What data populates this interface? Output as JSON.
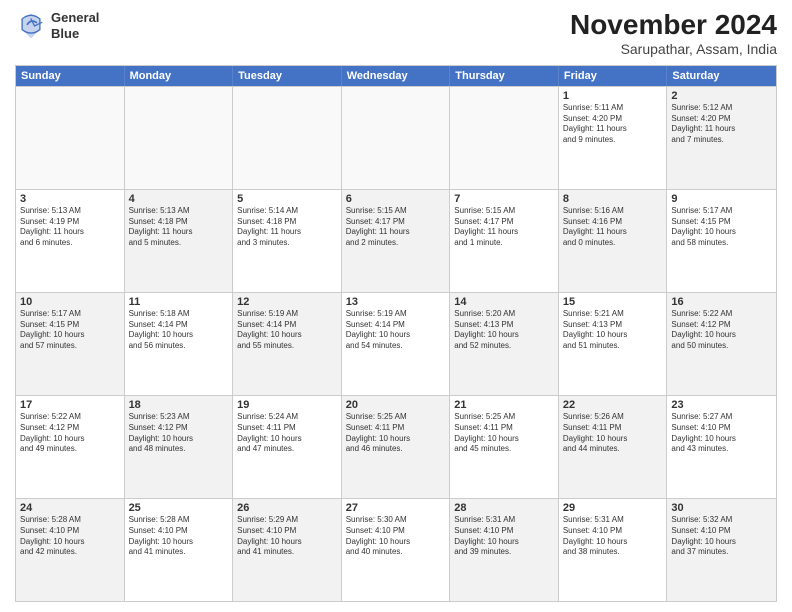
{
  "logo": {
    "line1": "General",
    "line2": "Blue"
  },
  "title": "November 2024",
  "subtitle": "Sarupathar, Assam, India",
  "header_days": [
    "Sunday",
    "Monday",
    "Tuesday",
    "Wednesday",
    "Thursday",
    "Friday",
    "Saturday"
  ],
  "rows": [
    [
      {
        "day": "",
        "info": "",
        "empty": true
      },
      {
        "day": "",
        "info": "",
        "empty": true
      },
      {
        "day": "",
        "info": "",
        "empty": true
      },
      {
        "day": "",
        "info": "",
        "empty": true
      },
      {
        "day": "",
        "info": "",
        "empty": true
      },
      {
        "day": "1",
        "info": "Sunrise: 5:11 AM\nSunset: 4:20 PM\nDaylight: 11 hours\nand 9 minutes.",
        "empty": false
      },
      {
        "day": "2",
        "info": "Sunrise: 5:12 AM\nSunset: 4:20 PM\nDaylight: 11 hours\nand 7 minutes.",
        "empty": false,
        "shaded": true
      }
    ],
    [
      {
        "day": "3",
        "info": "Sunrise: 5:13 AM\nSunset: 4:19 PM\nDaylight: 11 hours\nand 6 minutes.",
        "empty": false
      },
      {
        "day": "4",
        "info": "Sunrise: 5:13 AM\nSunset: 4:18 PM\nDaylight: 11 hours\nand 5 minutes.",
        "empty": false,
        "shaded": true
      },
      {
        "day": "5",
        "info": "Sunrise: 5:14 AM\nSunset: 4:18 PM\nDaylight: 11 hours\nand 3 minutes.",
        "empty": false
      },
      {
        "day": "6",
        "info": "Sunrise: 5:15 AM\nSunset: 4:17 PM\nDaylight: 11 hours\nand 2 minutes.",
        "empty": false,
        "shaded": true
      },
      {
        "day": "7",
        "info": "Sunrise: 5:15 AM\nSunset: 4:17 PM\nDaylight: 11 hours\nand 1 minute.",
        "empty": false
      },
      {
        "day": "8",
        "info": "Sunrise: 5:16 AM\nSunset: 4:16 PM\nDaylight: 11 hours\nand 0 minutes.",
        "empty": false,
        "shaded": true
      },
      {
        "day": "9",
        "info": "Sunrise: 5:17 AM\nSunset: 4:15 PM\nDaylight: 10 hours\nand 58 minutes.",
        "empty": false
      }
    ],
    [
      {
        "day": "10",
        "info": "Sunrise: 5:17 AM\nSunset: 4:15 PM\nDaylight: 10 hours\nand 57 minutes.",
        "empty": false,
        "shaded": true
      },
      {
        "day": "11",
        "info": "Sunrise: 5:18 AM\nSunset: 4:14 PM\nDaylight: 10 hours\nand 56 minutes.",
        "empty": false
      },
      {
        "day": "12",
        "info": "Sunrise: 5:19 AM\nSunset: 4:14 PM\nDaylight: 10 hours\nand 55 minutes.",
        "empty": false,
        "shaded": true
      },
      {
        "day": "13",
        "info": "Sunrise: 5:19 AM\nSunset: 4:14 PM\nDaylight: 10 hours\nand 54 minutes.",
        "empty": false
      },
      {
        "day": "14",
        "info": "Sunrise: 5:20 AM\nSunset: 4:13 PM\nDaylight: 10 hours\nand 52 minutes.",
        "empty": false,
        "shaded": true
      },
      {
        "day": "15",
        "info": "Sunrise: 5:21 AM\nSunset: 4:13 PM\nDaylight: 10 hours\nand 51 minutes.",
        "empty": false
      },
      {
        "day": "16",
        "info": "Sunrise: 5:22 AM\nSunset: 4:12 PM\nDaylight: 10 hours\nand 50 minutes.",
        "empty": false,
        "shaded": true
      }
    ],
    [
      {
        "day": "17",
        "info": "Sunrise: 5:22 AM\nSunset: 4:12 PM\nDaylight: 10 hours\nand 49 minutes.",
        "empty": false
      },
      {
        "day": "18",
        "info": "Sunrise: 5:23 AM\nSunset: 4:12 PM\nDaylight: 10 hours\nand 48 minutes.",
        "empty": false,
        "shaded": true
      },
      {
        "day": "19",
        "info": "Sunrise: 5:24 AM\nSunset: 4:11 PM\nDaylight: 10 hours\nand 47 minutes.",
        "empty": false
      },
      {
        "day": "20",
        "info": "Sunrise: 5:25 AM\nSunset: 4:11 PM\nDaylight: 10 hours\nand 46 minutes.",
        "empty": false,
        "shaded": true
      },
      {
        "day": "21",
        "info": "Sunrise: 5:25 AM\nSunset: 4:11 PM\nDaylight: 10 hours\nand 45 minutes.",
        "empty": false
      },
      {
        "day": "22",
        "info": "Sunrise: 5:26 AM\nSunset: 4:11 PM\nDaylight: 10 hours\nand 44 minutes.",
        "empty": false,
        "shaded": true
      },
      {
        "day": "23",
        "info": "Sunrise: 5:27 AM\nSunset: 4:10 PM\nDaylight: 10 hours\nand 43 minutes.",
        "empty": false
      }
    ],
    [
      {
        "day": "24",
        "info": "Sunrise: 5:28 AM\nSunset: 4:10 PM\nDaylight: 10 hours\nand 42 minutes.",
        "empty": false,
        "shaded": true
      },
      {
        "day": "25",
        "info": "Sunrise: 5:28 AM\nSunset: 4:10 PM\nDaylight: 10 hours\nand 41 minutes.",
        "empty": false
      },
      {
        "day": "26",
        "info": "Sunrise: 5:29 AM\nSunset: 4:10 PM\nDaylight: 10 hours\nand 41 minutes.",
        "empty": false,
        "shaded": true
      },
      {
        "day": "27",
        "info": "Sunrise: 5:30 AM\nSunset: 4:10 PM\nDaylight: 10 hours\nand 40 minutes.",
        "empty": false
      },
      {
        "day": "28",
        "info": "Sunrise: 5:31 AM\nSunset: 4:10 PM\nDaylight: 10 hours\nand 39 minutes.",
        "empty": false,
        "shaded": true
      },
      {
        "day": "29",
        "info": "Sunrise: 5:31 AM\nSunset: 4:10 PM\nDaylight: 10 hours\nand 38 minutes.",
        "empty": false
      },
      {
        "day": "30",
        "info": "Sunrise: 5:32 AM\nSunset: 4:10 PM\nDaylight: 10 hours\nand 37 minutes.",
        "empty": false,
        "shaded": true
      }
    ]
  ]
}
